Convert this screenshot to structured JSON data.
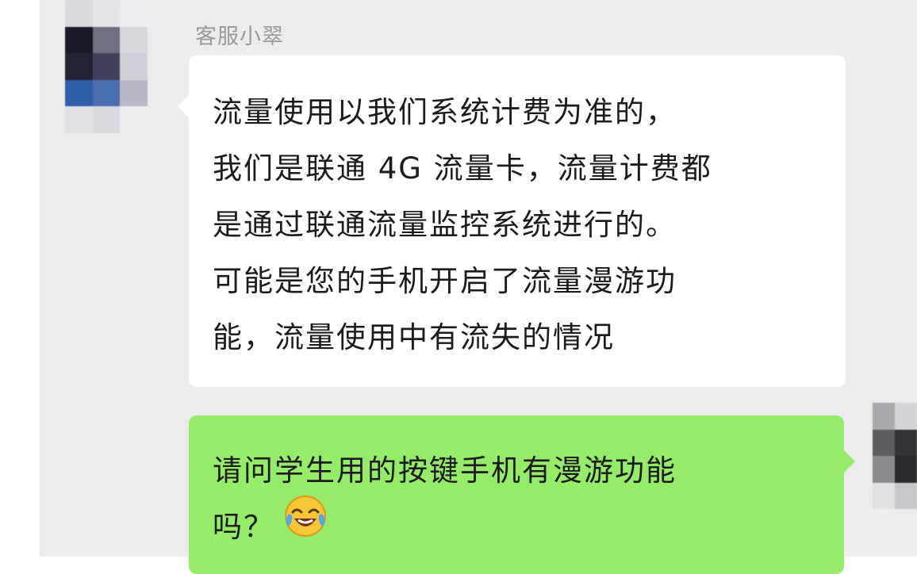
{
  "conversation": {
    "agent_message": {
      "sender_name": "客服小翠",
      "lines": [
        "流量使用以我们系统计费为准的，",
        "我们是联通 4G 流量卡，流量计费都",
        "是通过联通流量监控系统进行的。",
        "可能是您的手机开启了流量漫游功",
        "能，流量使用中有流失的情况"
      ]
    },
    "user_message": {
      "lines": [
        "请问学生用的按键手机有漫游功能",
        "吗？"
      ],
      "emoji": "crying-laughing-face-icon"
    }
  },
  "colors": {
    "chat_background": "#ececec",
    "incoming_bubble": "#ffffff",
    "outgoing_bubble": "#95ec69",
    "sender_name": "#9a9a9a"
  },
  "avatars": {
    "agent": [
      "#d8d8de",
      "#e6e6ea",
      "#ececf0",
      "#1a1a2a",
      "#6f6f82",
      "#d6d6dc",
      "#232336",
      "#40405a",
      "#cfcfd8",
      "#2e5ea8",
      "#4a6fb0",
      "#b8b8c8",
      "#e1e1e6",
      "#d9d9df",
      "#ececec"
    ],
    "user": [
      "#a8a8ae",
      "#d4d4d8",
      "#5c5c62",
      "#333338",
      "#8a8a90",
      "#2a2a2e",
      "#e2e2e4",
      "#c8c8cc"
    ]
  }
}
